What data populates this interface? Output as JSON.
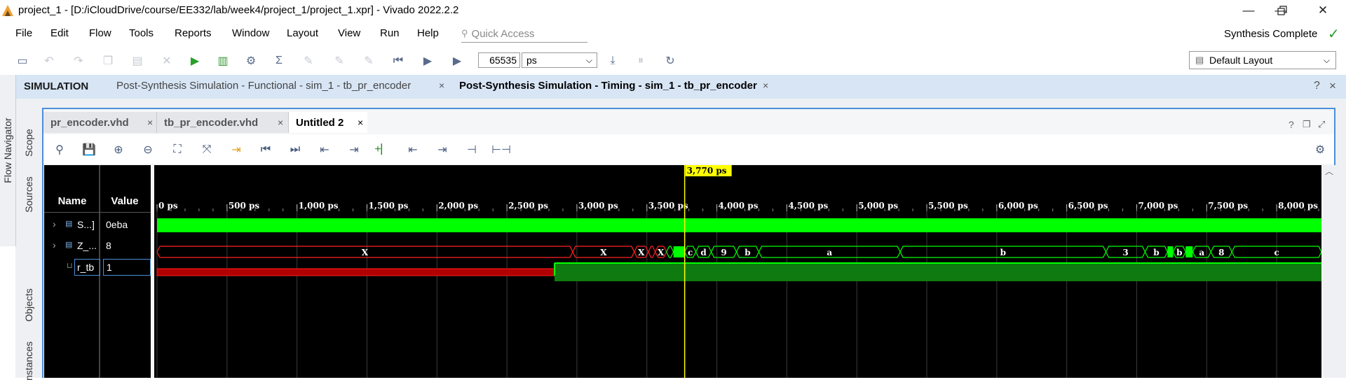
{
  "window": {
    "title": "project_1 - [D:/iCloudDrive/course/EE332/lab/week4/project_1/project_1.xpr] - Vivado 2022.2.2",
    "controls": [
      "—",
      "❐",
      "✕"
    ]
  },
  "menu": [
    "File",
    "Edit",
    "Flow",
    "Tools",
    "Reports",
    "Window",
    "Layout",
    "View",
    "Run",
    "Help"
  ],
  "quick_access": "Quick Access",
  "status": "Synthesis Complete",
  "toolbar": {
    "run_length": "65535",
    "time_unit": "ps",
    "layout": "Default Layout"
  },
  "simulation": {
    "label": "SIMULATION",
    "tabs": [
      "Post-Synthesis Simulation - Functional - sim_1 - tb_pr_encoder",
      "Post-Synthesis Simulation - Timing - sim_1 - tb_pr_encoder"
    ],
    "active_tab": 1
  },
  "side_tabs": {
    "flow": "Flow Navigator",
    "scope": "Scope",
    "sources": "Sources",
    "objects": "Objects",
    "instances": "nstances"
  },
  "editor_tabs": [
    "pr_encoder.vhd",
    "tb_pr_encoder.vhd",
    "Untitled 2"
  ],
  "waveform": {
    "headers": {
      "name": "Name",
      "value": "Value"
    },
    "cursor_label": "3,770 ps",
    "time_span_ps": 8320,
    "cursor_ps": 3770,
    "signals": [
      {
        "name": "S...]",
        "value": "0eba"
      },
      {
        "name": "Z_...",
        "value": "8"
      },
      {
        "name": "r_tb",
        "value": "1"
      }
    ],
    "ticks": [
      {
        "t": 0,
        "label": "0 ps"
      },
      {
        "t": 500,
        "label": "500 ps"
      },
      {
        "t": 1000,
        "label": "1,000 ps"
      },
      {
        "t": 1500,
        "label": "1,500 ps"
      },
      {
        "t": 2000,
        "label": "2,000 ps"
      },
      {
        "t": 2500,
        "label": "2,500 ps"
      },
      {
        "t": 3000,
        "label": "3,000 ps"
      },
      {
        "t": 3500,
        "label": "3,500 ps"
      },
      {
        "t": 4000,
        "label": "4,000 ps"
      },
      {
        "t": 4500,
        "label": "4,500 ps"
      },
      {
        "t": 5000,
        "label": "5,000 ps"
      },
      {
        "t": 5500,
        "label": "5,500 ps"
      },
      {
        "t": 6000,
        "label": "6,000 ps"
      },
      {
        "t": 6500,
        "label": "6,500 ps"
      },
      {
        "t": 7000,
        "label": "7,000 ps"
      },
      {
        "t": 7500,
        "label": "7,500 ps"
      },
      {
        "t": 8000,
        "label": "8,000 ps"
      }
    ],
    "bus_segments": [
      {
        "start": 0,
        "end": 2970,
        "label": "X",
        "state": "x"
      },
      {
        "start": 2970,
        "end": 3410,
        "label": "X",
        "state": "x"
      },
      {
        "start": 3410,
        "end": 3510,
        "label": "X",
        "state": "x"
      },
      {
        "start": 3510,
        "end": 3560,
        "label": "",
        "state": "x"
      },
      {
        "start": 3560,
        "end": 3640,
        "label": "X",
        "state": "x"
      },
      {
        "start": 3640,
        "end": 3690,
        "label": "",
        "state": "v"
      },
      {
        "start": 3690,
        "end": 3770,
        "label": "",
        "state": "fill"
      },
      {
        "start": 3770,
        "end": 3850,
        "label": "c",
        "state": "v"
      },
      {
        "start": 3850,
        "end": 3960,
        "label": "d",
        "state": "v"
      },
      {
        "start": 3960,
        "end": 4140,
        "label": "9",
        "state": "v"
      },
      {
        "start": 4140,
        "end": 4300,
        "label": "b",
        "state": "v"
      },
      {
        "start": 4300,
        "end": 5310,
        "label": "a",
        "state": "v"
      },
      {
        "start": 5310,
        "end": 6780,
        "label": "b",
        "state": "v"
      },
      {
        "start": 6780,
        "end": 7060,
        "label": "3",
        "state": "v"
      },
      {
        "start": 7060,
        "end": 7220,
        "label": "b",
        "state": "v"
      },
      {
        "start": 7220,
        "end": 7260,
        "label": "",
        "state": "fill"
      },
      {
        "start": 7260,
        "end": 7350,
        "label": "b",
        "state": "v"
      },
      {
        "start": 7350,
        "end": 7400,
        "label": "",
        "state": "fill"
      },
      {
        "start": 7400,
        "end": 7530,
        "label": "a",
        "state": "v"
      },
      {
        "start": 7530,
        "end": 7680,
        "label": "8",
        "state": "v"
      },
      {
        "start": 7680,
        "end": 8320,
        "label": "c",
        "state": "v"
      }
    ],
    "bit_transition_ps": 2840
  },
  "colors": {
    "wave_green": "#00ff00",
    "dark_green": "#0f7a0f",
    "wave_red": "#ff2020",
    "cursor": "#ffff00",
    "grid": "#3a3a3a"
  }
}
